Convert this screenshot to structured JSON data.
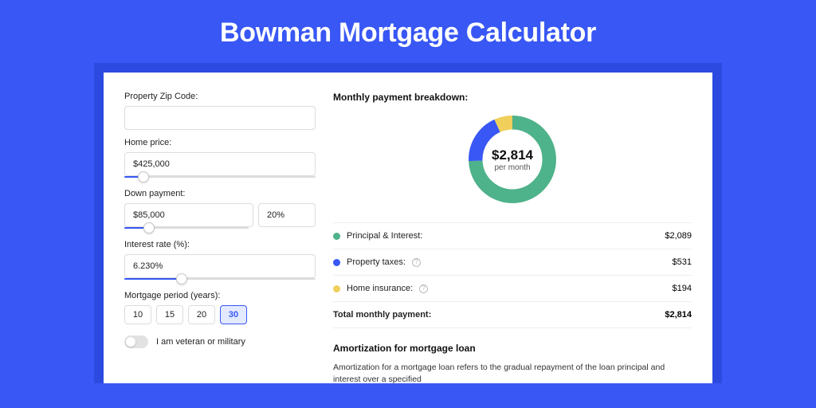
{
  "title": "Bowman Mortgage Calculator",
  "colors": {
    "blue": "#3857f4",
    "green": "#4eb28a",
    "yellow": "#f0cf5b"
  },
  "form": {
    "zip": {
      "label": "Property Zip Code:",
      "value": ""
    },
    "home_price": {
      "label": "Home price:",
      "value": "$425,000",
      "slider_pct": 10
    },
    "down_payment": {
      "label": "Down payment:",
      "amount": "$85,000",
      "percent": "20%",
      "slider_pct": 20
    },
    "interest_rate": {
      "label": "Interest rate (%):",
      "value": "6.230%",
      "slider_pct": 30
    },
    "mortgage_period": {
      "label": "Mortgage period (years):",
      "options": [
        "10",
        "15",
        "20",
        "30"
      ],
      "active": "30"
    },
    "veteran": {
      "label": "I am veteran or military",
      "on": false
    }
  },
  "breakdown": {
    "title": "Monthly payment breakdown:",
    "center_amount": "$2,814",
    "center_sub": "per month",
    "items": [
      {
        "key": "principal_interest",
        "label": "Principal & Interest:",
        "value": "$2,089",
        "num": 2089,
        "color": "#4eb28a"
      },
      {
        "key": "property_taxes",
        "label": "Property taxes:",
        "value": "$531",
        "num": 531,
        "color": "#3857f4",
        "info": true
      },
      {
        "key": "home_insurance",
        "label": "Home insurance:",
        "value": "$194",
        "num": 194,
        "color": "#f0cf5b",
        "info": true
      }
    ],
    "total": {
      "label": "Total monthly payment:",
      "value": "$2,814",
      "num": 2814
    }
  },
  "amortization": {
    "title": "Amortization for mortgage loan",
    "body": "Amortization for a mortgage loan refers to the gradual repayment of the loan principal and interest over a specified"
  },
  "chart_data": {
    "type": "pie",
    "title": "Monthly payment breakdown",
    "categories": [
      "Principal & Interest",
      "Property taxes",
      "Home insurance"
    ],
    "values": [
      2089,
      531,
      194
    ],
    "colors": [
      "#4eb28a",
      "#3857f4",
      "#f0cf5b"
    ],
    "total": 2814,
    "center_label": "$2,814 per month"
  }
}
